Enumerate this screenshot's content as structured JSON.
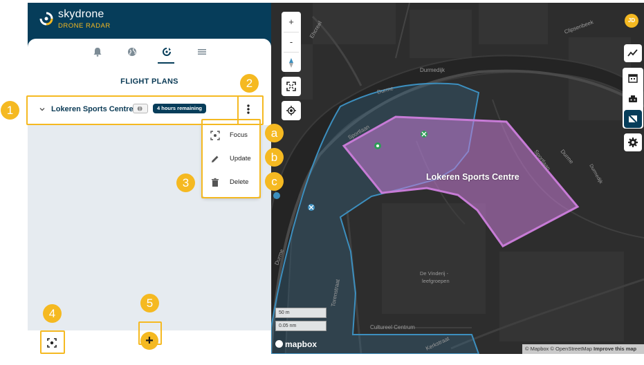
{
  "brand": {
    "name": "skydrone",
    "subtitle": "DRONE RADAR"
  },
  "nav_tabs": [
    {
      "icon": "bell-icon"
    },
    {
      "icon": "globe-icon"
    },
    {
      "icon": "flight-plan-icon",
      "active": true
    },
    {
      "icon": "menu-icon"
    }
  ],
  "section": {
    "title": "FLIGHT PLANS"
  },
  "flight_plans": [
    {
      "name": "Lokeren Sports Centre",
      "remaining": "4 hours remaining"
    }
  ],
  "context_menu": {
    "items": [
      {
        "label": "Focus",
        "icon": "focus-icon"
      },
      {
        "label": "Update",
        "icon": "pencil-icon"
      },
      {
        "label": "Delete",
        "icon": "trash-icon"
      }
    ]
  },
  "bottom_bar": {
    "add_label": "+"
  },
  "map": {
    "zoom_in": "+",
    "zoom_out": "-",
    "user_initials": "JD",
    "polygon_label": "Lokeren Sports Centre",
    "street_labels": [
      "Durmedijk",
      "Durme",
      "Sportlaan",
      "Sportlaan",
      "Durme",
      "Durmedijk",
      "Clipsenbeek",
      "Torenstraat",
      "Durme",
      "Cultureel Centrum",
      "De Vinderij -",
      "leefgroepen",
      "Kerkstraat",
      "Ehcreel"
    ],
    "scale_1": "50 m",
    "scale_2": "0.05 nm",
    "logo": "mapbox",
    "attribution": {
      "text": "© Mapbox © OpenStreetMap",
      "improve": "Improve this map"
    },
    "colors": {
      "fp_polygon": "#c77bd6",
      "zone_outline": "#3c8fbf"
    }
  },
  "callouts": {
    "one": "1",
    "two": "2",
    "three": "3",
    "a": "a",
    "b": "b",
    "c": "c",
    "four": "4",
    "five": "5"
  }
}
